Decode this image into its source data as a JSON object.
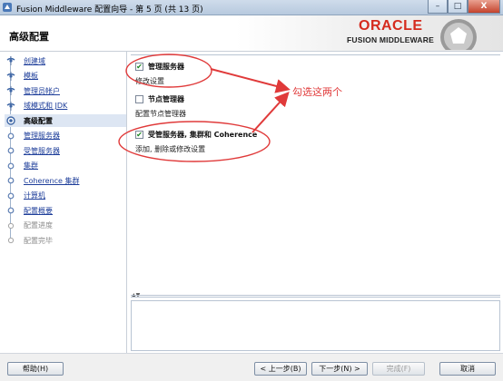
{
  "window": {
    "title": "Fusion Middleware 配置向导 - 第 5 页 (共 13 页)",
    "controls": {
      "minimize": "–",
      "maximize": "□",
      "close": "X"
    }
  },
  "header": {
    "page_title": "高级配置",
    "brand_name": "ORACLE",
    "brand_subtitle": "FUSION MIDDLEWARE"
  },
  "nav": {
    "items": [
      {
        "label": "创建域",
        "state": "done"
      },
      {
        "label": "模板",
        "state": "done"
      },
      {
        "label": "管理员帐户",
        "state": "done"
      },
      {
        "label": "域模式和 JDK",
        "state": "done"
      },
      {
        "label": "高级配置",
        "state": "current"
      },
      {
        "label": "管理服务器",
        "state": "pending"
      },
      {
        "label": "受管服务器",
        "state": "pending"
      },
      {
        "label": "集群",
        "state": "pending"
      },
      {
        "label": "Coherence 集群",
        "state": "pending"
      },
      {
        "label": "计算机",
        "state": "pending"
      },
      {
        "label": "配置概要",
        "state": "pending"
      },
      {
        "label": "配置进度",
        "state": "disabled"
      },
      {
        "label": "配置完毕",
        "state": "disabled"
      }
    ]
  },
  "options": [
    {
      "label": "管理服务器",
      "checked": true,
      "description": "修改设置"
    },
    {
      "label": "节点管理器",
      "checked": false,
      "description": "配置节点管理器"
    },
    {
      "label": "受管服务器, 集群和 Coherence",
      "checked": true,
      "description": "添加, 删除或修改设置"
    }
  ],
  "annotation": {
    "text": "勾选这两个",
    "color": "#e03a3a"
  },
  "buttons": {
    "help": "帮助(H)",
    "back": "< 上一步(B)",
    "next": "下一步(N) >",
    "finish": "完成(F)",
    "cancel": "取消"
  },
  "colors": {
    "accent": "#d52b1e",
    "link": "#1e3e9a",
    "check": "#16841f"
  }
}
